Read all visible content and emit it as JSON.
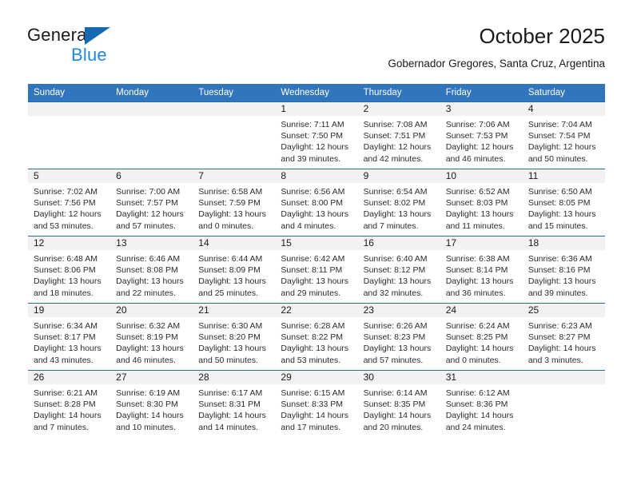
{
  "brand": {
    "name_part1": "General",
    "name_part2": "Blue",
    "triangle_color": "#1569b0",
    "blue_color": "#2389d6"
  },
  "header": {
    "title": "October 2025",
    "subtitle": "Gobernador Gregores, Santa Cruz, Argentina"
  },
  "theme": {
    "header_row_bg": "#3176bc",
    "row_border": "#2c6aa8",
    "daynum_bg": "#f2f2f2"
  },
  "calendar": {
    "weekday_headers": [
      "Sunday",
      "Monday",
      "Tuesday",
      "Wednesday",
      "Thursday",
      "Friday",
      "Saturday"
    ],
    "weeks": [
      [
        {
          "day": "",
          "lines": []
        },
        {
          "day": "",
          "lines": []
        },
        {
          "day": "",
          "lines": []
        },
        {
          "day": "1",
          "lines": [
            "Sunrise: 7:11 AM",
            "Sunset: 7:50 PM",
            "Daylight: 12 hours",
            "and 39 minutes."
          ]
        },
        {
          "day": "2",
          "lines": [
            "Sunrise: 7:08 AM",
            "Sunset: 7:51 PM",
            "Daylight: 12 hours",
            "and 42 minutes."
          ]
        },
        {
          "day": "3",
          "lines": [
            "Sunrise: 7:06 AM",
            "Sunset: 7:53 PM",
            "Daylight: 12 hours",
            "and 46 minutes."
          ]
        },
        {
          "day": "4",
          "lines": [
            "Sunrise: 7:04 AM",
            "Sunset: 7:54 PM",
            "Daylight: 12 hours",
            "and 50 minutes."
          ]
        }
      ],
      [
        {
          "day": "5",
          "lines": [
            "Sunrise: 7:02 AM",
            "Sunset: 7:56 PM",
            "Daylight: 12 hours",
            "and 53 minutes."
          ]
        },
        {
          "day": "6",
          "lines": [
            "Sunrise: 7:00 AM",
            "Sunset: 7:57 PM",
            "Daylight: 12 hours",
            "and 57 minutes."
          ]
        },
        {
          "day": "7",
          "lines": [
            "Sunrise: 6:58 AM",
            "Sunset: 7:59 PM",
            "Daylight: 13 hours",
            "and 0 minutes."
          ]
        },
        {
          "day": "8",
          "lines": [
            "Sunrise: 6:56 AM",
            "Sunset: 8:00 PM",
            "Daylight: 13 hours",
            "and 4 minutes."
          ]
        },
        {
          "day": "9",
          "lines": [
            "Sunrise: 6:54 AM",
            "Sunset: 8:02 PM",
            "Daylight: 13 hours",
            "and 7 minutes."
          ]
        },
        {
          "day": "10",
          "lines": [
            "Sunrise: 6:52 AM",
            "Sunset: 8:03 PM",
            "Daylight: 13 hours",
            "and 11 minutes."
          ]
        },
        {
          "day": "11",
          "lines": [
            "Sunrise: 6:50 AM",
            "Sunset: 8:05 PM",
            "Daylight: 13 hours",
            "and 15 minutes."
          ]
        }
      ],
      [
        {
          "day": "12",
          "lines": [
            "Sunrise: 6:48 AM",
            "Sunset: 8:06 PM",
            "Daylight: 13 hours",
            "and 18 minutes."
          ]
        },
        {
          "day": "13",
          "lines": [
            "Sunrise: 6:46 AM",
            "Sunset: 8:08 PM",
            "Daylight: 13 hours",
            "and 22 minutes."
          ]
        },
        {
          "day": "14",
          "lines": [
            "Sunrise: 6:44 AM",
            "Sunset: 8:09 PM",
            "Daylight: 13 hours",
            "and 25 minutes."
          ]
        },
        {
          "day": "15",
          "lines": [
            "Sunrise: 6:42 AM",
            "Sunset: 8:11 PM",
            "Daylight: 13 hours",
            "and 29 minutes."
          ]
        },
        {
          "day": "16",
          "lines": [
            "Sunrise: 6:40 AM",
            "Sunset: 8:12 PM",
            "Daylight: 13 hours",
            "and 32 minutes."
          ]
        },
        {
          "day": "17",
          "lines": [
            "Sunrise: 6:38 AM",
            "Sunset: 8:14 PM",
            "Daylight: 13 hours",
            "and 36 minutes."
          ]
        },
        {
          "day": "18",
          "lines": [
            "Sunrise: 6:36 AM",
            "Sunset: 8:16 PM",
            "Daylight: 13 hours",
            "and 39 minutes."
          ]
        }
      ],
      [
        {
          "day": "19",
          "lines": [
            "Sunrise: 6:34 AM",
            "Sunset: 8:17 PM",
            "Daylight: 13 hours",
            "and 43 minutes."
          ]
        },
        {
          "day": "20",
          "lines": [
            "Sunrise: 6:32 AM",
            "Sunset: 8:19 PM",
            "Daylight: 13 hours",
            "and 46 minutes."
          ]
        },
        {
          "day": "21",
          "lines": [
            "Sunrise: 6:30 AM",
            "Sunset: 8:20 PM",
            "Daylight: 13 hours",
            "and 50 minutes."
          ]
        },
        {
          "day": "22",
          "lines": [
            "Sunrise: 6:28 AM",
            "Sunset: 8:22 PM",
            "Daylight: 13 hours",
            "and 53 minutes."
          ]
        },
        {
          "day": "23",
          "lines": [
            "Sunrise: 6:26 AM",
            "Sunset: 8:23 PM",
            "Daylight: 13 hours",
            "and 57 minutes."
          ]
        },
        {
          "day": "24",
          "lines": [
            "Sunrise: 6:24 AM",
            "Sunset: 8:25 PM",
            "Daylight: 14 hours",
            "and 0 minutes."
          ]
        },
        {
          "day": "25",
          "lines": [
            "Sunrise: 6:23 AM",
            "Sunset: 8:27 PM",
            "Daylight: 14 hours",
            "and 3 minutes."
          ]
        }
      ],
      [
        {
          "day": "26",
          "lines": [
            "Sunrise: 6:21 AM",
            "Sunset: 8:28 PM",
            "Daylight: 14 hours",
            "and 7 minutes."
          ]
        },
        {
          "day": "27",
          "lines": [
            "Sunrise: 6:19 AM",
            "Sunset: 8:30 PM",
            "Daylight: 14 hours",
            "and 10 minutes."
          ]
        },
        {
          "day": "28",
          "lines": [
            "Sunrise: 6:17 AM",
            "Sunset: 8:31 PM",
            "Daylight: 14 hours",
            "and 14 minutes."
          ]
        },
        {
          "day": "29",
          "lines": [
            "Sunrise: 6:15 AM",
            "Sunset: 8:33 PM",
            "Daylight: 14 hours",
            "and 17 minutes."
          ]
        },
        {
          "day": "30",
          "lines": [
            "Sunrise: 6:14 AM",
            "Sunset: 8:35 PM",
            "Daylight: 14 hours",
            "and 20 minutes."
          ]
        },
        {
          "day": "31",
          "lines": [
            "Sunrise: 6:12 AM",
            "Sunset: 8:36 PM",
            "Daylight: 14 hours",
            "and 24 minutes."
          ]
        },
        {
          "day": "",
          "lines": []
        }
      ]
    ]
  }
}
